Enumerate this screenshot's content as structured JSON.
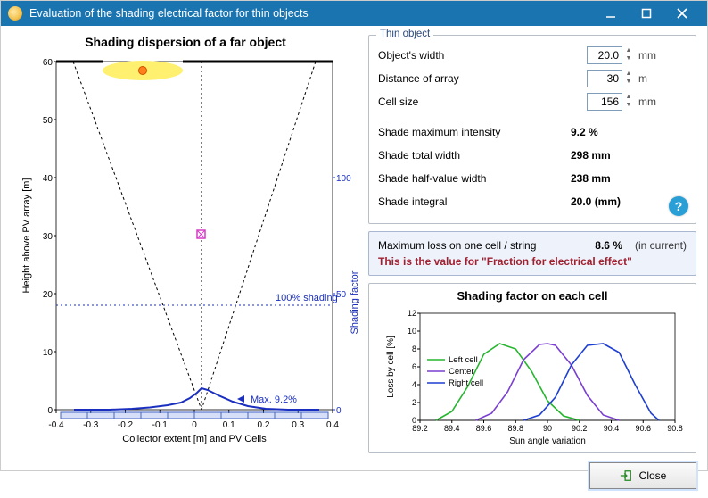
{
  "window": {
    "title": "Evaluation of the shading electrical factor for thin objects",
    "close_label": "Close"
  },
  "thin_object": {
    "legend": "Thin object",
    "width_label": "Object's width",
    "width_value": "20.0",
    "width_unit": "mm",
    "distance_label": "Distance of array",
    "distance_value": "30",
    "distance_unit": "m",
    "cellsize_label": "Cell size",
    "cellsize_value": "156",
    "cellsize_unit": "mm",
    "max_intensity_label": "Shade maximum intensity",
    "max_intensity_value": "9.2 %",
    "total_width_label": "Shade total width",
    "total_width_value": "298 mm",
    "half_width_label": "Shade half-value width",
    "half_width_value": "238 mm",
    "integral_label": "Shade integral",
    "integral_value": "20.0 (mm)"
  },
  "summary": {
    "label": "Maximum loss on one cell / string",
    "value": "8.6 %",
    "note": "(in current)",
    "row2": "This is the value for \"Fraction for electrical effect\""
  },
  "chart_data": [
    {
      "type": "line",
      "title": "Shading dispersion of a far object",
      "xlabel": "Collector extent [m] and PV Cells",
      "ylabel_left": "Height above PV array [m]",
      "ylabel_right": "Shading factor",
      "xlim": [
        -0.4,
        0.4
      ],
      "ylim_left": [
        0,
        60
      ],
      "ylim_right": [
        0,
        100
      ],
      "xticks": [
        -0.4,
        -0.3,
        -0.2,
        -0.1,
        0,
        0.1,
        0.2,
        0.3,
        0.4
      ],
      "yticks_left": [
        0,
        10,
        20,
        30,
        40,
        50,
        60
      ],
      "annotations": [
        "100% shading",
        "Max. 9.2%"
      ],
      "series": [
        {
          "name": "Shade envelope",
          "type": "lines",
          "points": [
            [
              -0.35,
              60
            ],
            [
              0.02,
              0
            ]
          ],
          "style": "dashed-black"
        },
        {
          "name": "Shade envelope2",
          "type": "lines",
          "points": [
            [
              0.35,
              60
            ],
            [
              0.02,
              0
            ]
          ],
          "style": "dashed-black"
        },
        {
          "name": "Half line",
          "type": "lines",
          "points": [
            [
              -0.4,
              18
            ],
            [
              0.4,
              18
            ]
          ],
          "style": "dotted-blue"
        },
        {
          "name": "Shading factor",
          "type": "line",
          "x": [
            -0.35,
            -0.3,
            -0.25,
            -0.2,
            -0.15,
            -0.1,
            -0.05,
            0,
            0.02,
            0.05,
            0.1,
            0.15,
            0.2,
            0.25,
            0.3,
            0.35
          ],
          "y_right": [
            0,
            0,
            0,
            0,
            0.3,
            1.2,
            3.5,
            7.5,
            9.2,
            8.5,
            6.0,
            3.0,
            1.0,
            0.3,
            0,
            0
          ]
        }
      ],
      "markers": [
        {
          "name": "sun",
          "x": -0.15,
          "y_left": 60
        },
        {
          "name": "pink-box",
          "x": 0.02,
          "y_left": 30.5
        }
      ]
    },
    {
      "type": "line",
      "title": "Shading factor on each cell",
      "xlabel": "Sun angle variation",
      "ylabel": "Loss by cell [%]",
      "xlim": [
        89.2,
        90.8
      ],
      "ylim": [
        0,
        12
      ],
      "xticks": [
        89.2,
        89.4,
        89.6,
        89.8,
        90,
        90.2,
        90.4,
        90.6,
        90.8
      ],
      "yticks": [
        0,
        2,
        4,
        6,
        8,
        10,
        12
      ],
      "series": [
        {
          "name": "Left cell",
          "color": "#26b52e",
          "x": [
            89.3,
            89.4,
            89.5,
            89.6,
            89.7,
            89.8,
            89.9,
            90.0,
            90.1,
            90.2
          ],
          "y": [
            0,
            1.0,
            3.8,
            7.4,
            8.6,
            8.0,
            5.5,
            2.2,
            0.5,
            0
          ]
        },
        {
          "name": "Center",
          "color": "#7a3fd1",
          "x": [
            89.55,
            89.65,
            89.75,
            89.85,
            89.95,
            90.0,
            90.05,
            90.15,
            90.25,
            90.35,
            90.45
          ],
          "y": [
            0,
            0.8,
            3.2,
            6.8,
            8.5,
            8.6,
            8.4,
            6.2,
            2.8,
            0.6,
            0
          ]
        },
        {
          "name": "Right cell",
          "color": "#1f3fd1",
          "x": [
            89.85,
            89.95,
            90.05,
            90.15,
            90.25,
            90.35,
            90.45,
            90.55,
            90.65,
            90.7
          ],
          "y": [
            0,
            0.6,
            2.6,
            6.2,
            8.4,
            8.6,
            7.6,
            4.0,
            0.8,
            0
          ]
        }
      ],
      "legend_entries": [
        "Left cell",
        "Center",
        "Right cell"
      ]
    }
  ]
}
